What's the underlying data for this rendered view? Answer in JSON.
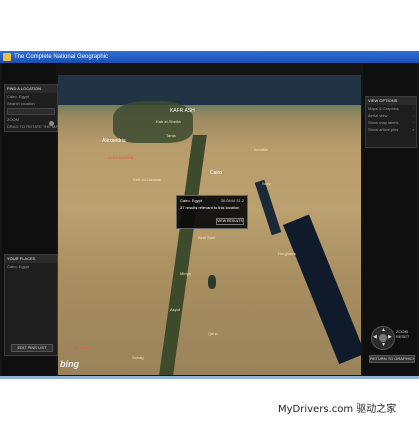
{
  "window": {
    "title": "The Complete National Geographic"
  },
  "left_panel": {
    "location_header": "FIND A LOCATION",
    "location_value": "Cairo, Egypt",
    "location_hint": "Search location",
    "zoom_label": "ZOOM",
    "pitch_label": "DRAG TO ROTATE THE MAP",
    "saved_header": "YOUR PLACES",
    "saved_item": "Cairo, Egypt",
    "clear_button": "EDIT PINS LIST"
  },
  "map": {
    "labels": [
      {
        "text": "KAFR ASH",
        "style": "big"
      },
      {
        "text": "Alexandria",
        "style": "big"
      },
      {
        "text": "Cairo",
        "style": "big"
      },
      {
        "text": "Kafr el-Sheikh",
        "style": "normal"
      },
      {
        "text": "Tanta",
        "style": "normal"
      },
      {
        "text": "Ismailia",
        "style": "normal"
      },
      {
        "text": "Suez",
        "style": "normal"
      },
      {
        "text": "ALEXANDRIA",
        "style": "red"
      },
      {
        "text": "Kafr ad-Dawwar",
        "style": "normal"
      },
      {
        "text": "Beni Suef",
        "style": "normal"
      },
      {
        "text": "Minya",
        "style": "normal"
      },
      {
        "text": "Asyut",
        "style": "normal"
      },
      {
        "text": "Qena",
        "style": "normal"
      },
      {
        "text": "Hurghada",
        "style": "normal"
      },
      {
        "text": "EL GIZA",
        "style": "red"
      },
      {
        "text": "Sohag",
        "style": "normal"
      }
    ],
    "brand": "bing"
  },
  "popup": {
    "place": "Cairo, Egypt",
    "ref": "30.0444 31.2",
    "message": "37 results relevant to this location",
    "view_button": "VIEW RESULTS"
  },
  "right_panel": {
    "header": "VIEW OPTIONS",
    "items": [
      {
        "label": "Maps & Graphics",
        "mark": "·"
      },
      {
        "label": "Aerial view",
        "mark": "·"
      },
      {
        "label": "Show map labels",
        "mark": "·"
      },
      {
        "label": "Show article pins",
        "mark": "▪"
      }
    ],
    "zoom_in": "ZOOM",
    "zoom_out": "RESET",
    "return_button": "RETURN TO GRAPHICS VIEW"
  },
  "footer": {
    "watermark": "MyDrivers.com 驱动之家"
  }
}
